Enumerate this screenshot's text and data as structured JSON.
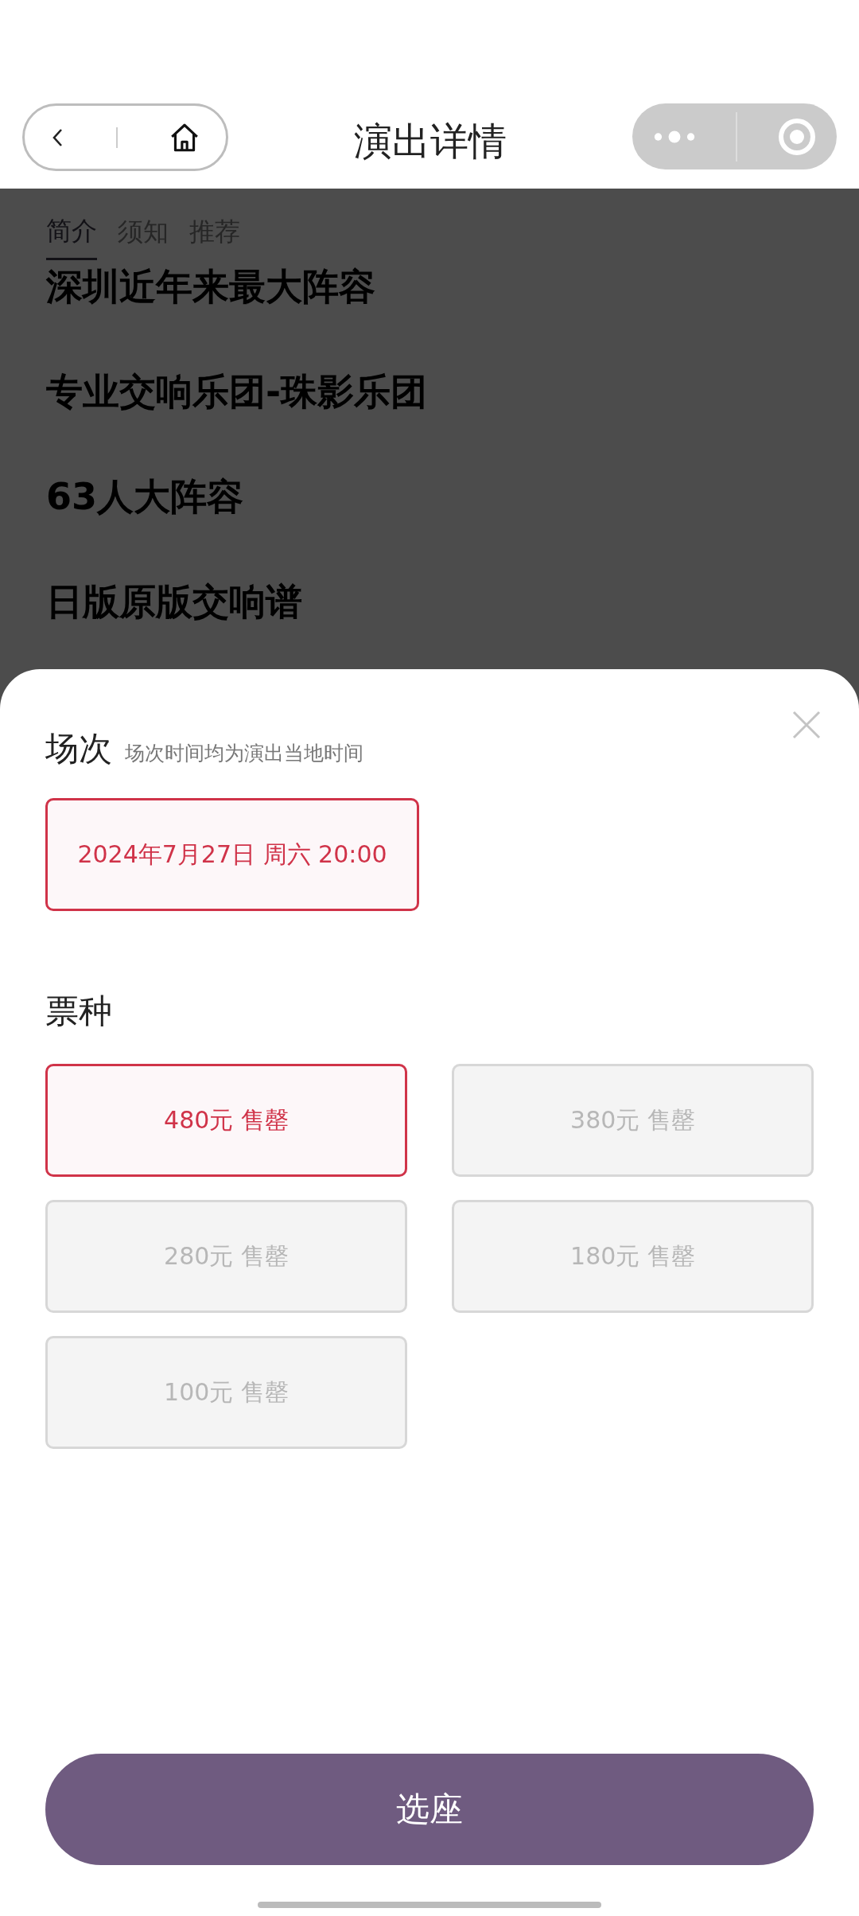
{
  "nav_bar": {
    "title": "演出详情"
  },
  "tabs": [
    {
      "label": "简介",
      "selected": true
    },
    {
      "label": "须知",
      "selected": false
    },
    {
      "label": "推荐",
      "selected": false
    }
  ],
  "highlights": [
    "深圳近年来最大阵容",
    "专业交响乐团-珠影乐团",
    "63人大阵容",
    "日版原版交响谱"
  ],
  "sheet": {
    "session_title": "场次",
    "session_note": "场次时间均为演出当地时间",
    "sessions": [
      {
        "label": "2024年7月27日 周六 20:00",
        "selected": true
      }
    ],
    "ticket_title": "票种",
    "tickets": [
      {
        "label": "480元 售罄",
        "selected": true
      },
      {
        "label": "380元 售罄",
        "selected": false
      },
      {
        "label": "280元 售罄",
        "selected": false
      },
      {
        "label": "180元 售罄",
        "selected": false
      },
      {
        "label": "100元 售罄",
        "selected": false
      }
    ],
    "confirm_button": "选座"
  }
}
